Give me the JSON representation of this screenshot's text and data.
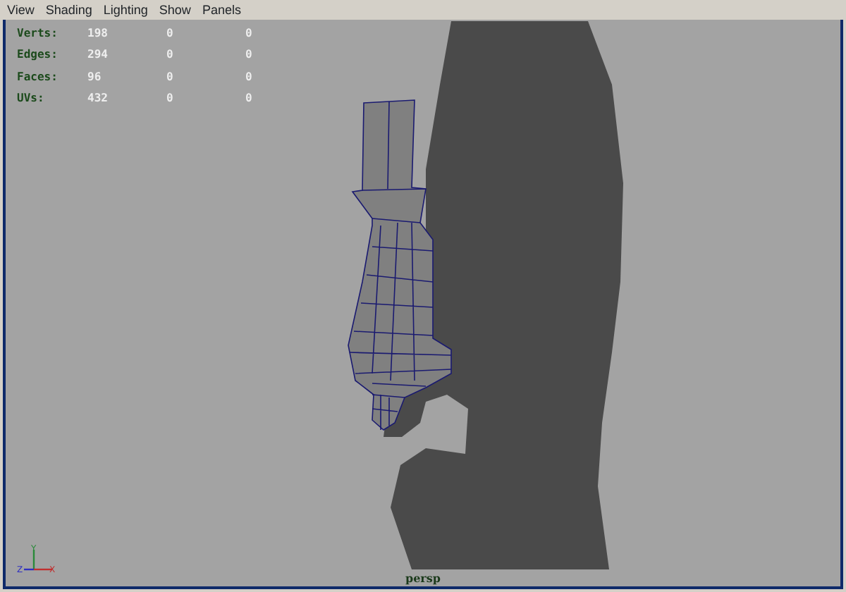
{
  "menu": [
    "View",
    "Shading",
    "Lighting",
    "Show",
    "Panels"
  ],
  "hud": [
    {
      "label": "Verts:",
      "values": [
        "198",
        "0",
        "0"
      ]
    },
    {
      "label": "Edges:",
      "values": [
        "294",
        "0",
        "0"
      ]
    },
    {
      "label": "Faces:",
      "values": [
        "96",
        "0",
        "0"
      ]
    },
    {
      "label": "UVs:",
      "values": [
        "432",
        "0",
        "0"
      ]
    }
  ],
  "axis_labels": [
    "Y",
    "Z",
    "X"
  ],
  "camera": "persp"
}
